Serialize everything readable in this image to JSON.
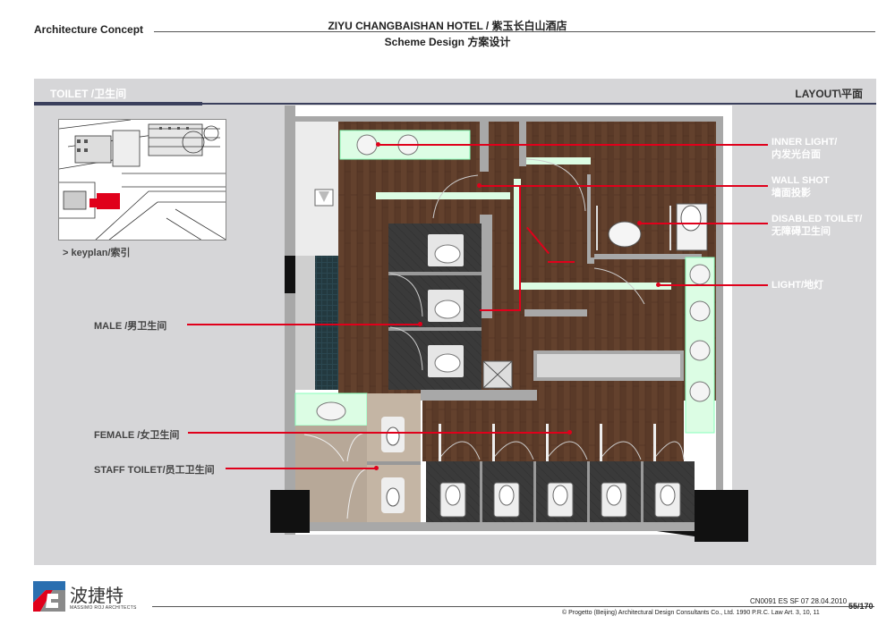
{
  "header": {
    "section": "Architecture Concept",
    "project": "ZIYU CHANGBAISHAN HOTEL / 紫玉长白山酒店",
    "phase": "Scheme Design 方案设计"
  },
  "panel": {
    "tab_left": "TOILET /卫生间",
    "tab_right": "LAYOUT\\平面",
    "keyplan_label": "> keyplan/索引"
  },
  "labels_left": {
    "male": "MALE /男卫生间",
    "female": "FEMALE /女卫生间",
    "staff": "STAFF TOILET/员工卫生间"
  },
  "labels_right": {
    "inner_light_1": "INNER LIGHT/",
    "inner_light_2": "内发光台面",
    "wall_shot_1": "WALL SHOT",
    "wall_shot_2": "墙面投影",
    "disabled_1": "DISABLED TOILET/",
    "disabled_2": "无障碍卫生间",
    "light": "LIGHT/地灯"
  },
  "logo": {
    "name_cn": "波捷特",
    "name_en": "MASSIMO ROJ ARCHITECTS"
  },
  "footer": {
    "code": "CN0091 ES SF 07  28.04.2010",
    "page": "55/170",
    "copyright": "© Progetto (Beijing) Architectural Design Consultants Co., Ltd. 1990 P.R.C. Law  Art. 3, 10, 11"
  },
  "colors": {
    "panel": "#d6d6d8",
    "accent_line": "#e0001b",
    "tab_bar": "#3a3f5c",
    "floor_wood": "#5a3a28",
    "glow": "#dcfde4"
  }
}
